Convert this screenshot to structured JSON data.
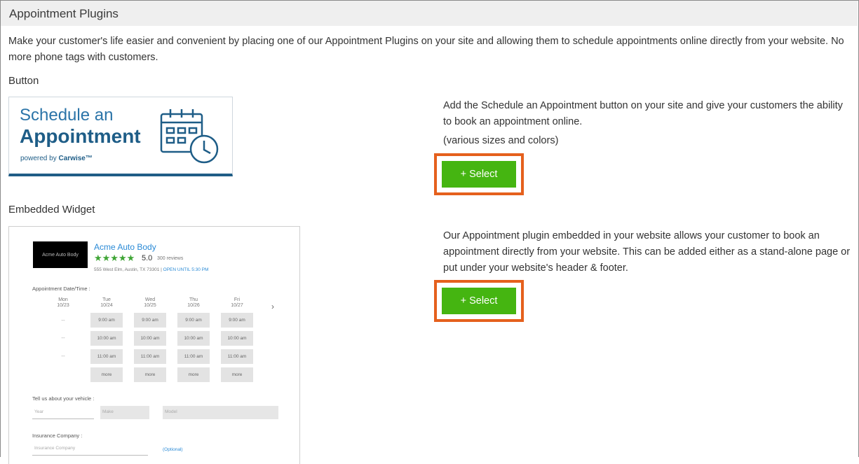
{
  "page": {
    "title": "Appointment Plugins",
    "intro": "Make your customer's life easier and convenient by placing one of our Appointment Plugins on your site and allowing them to schedule appointments online directly from your website. No more phone tags with customers."
  },
  "button_section": {
    "heading": "Button",
    "preview": {
      "line1": "Schedule an",
      "line2": "Appointment",
      "powered_prefix": "powered by ",
      "powered_brand": "Carwise™"
    },
    "description": "Add the Schedule an Appointment button on your site and give your customers the ability to book an appointment online.",
    "note": "(various sizes and colors)",
    "select_label": "+ Select"
  },
  "widget_section": {
    "heading": "Embedded Widget",
    "description": "Our Appointment plugin embedded in your website allows your customer to book an appointment directly from your website. This can be added either as a stand-alone page or put under your website's header & footer.",
    "select_label": "+ Select",
    "preview": {
      "logo_text": "Acme Auto Body",
      "name": "Acme Auto Body",
      "stars": "★★★★★",
      "score": "5.0",
      "reviews": "300 reviews",
      "address": "555 West Elm, Austin, TX 73301",
      "separator": " | ",
      "open": "OPEN UNTIL 5:30 PM",
      "date_label": "Appointment Date/Time :",
      "days": [
        {
          "day": "Mon",
          "date": "10/23"
        },
        {
          "day": "Tue",
          "date": "10/24"
        },
        {
          "day": "Wed",
          "date": "10/25"
        },
        {
          "day": "Thu",
          "date": "10/26"
        },
        {
          "day": "Fri",
          "date": "10/27"
        }
      ],
      "unavailable": "--",
      "times": [
        "9:00 am",
        "10:00 am",
        "11:00 am"
      ],
      "more": "more",
      "next_glyph": "›",
      "vehicle_label": "Tell us about your vehicle :",
      "year_placeholder": "Year",
      "make_placeholder": "Make",
      "model_placeholder": "Model",
      "insurance_label": "Insurance Company :",
      "insurance_placeholder": "Insurance Company",
      "optional": "(Optional)"
    }
  },
  "colors": {
    "select_green": "#45b511",
    "highlight_orange": "#e5601d",
    "brand_blue": "#1e5d87"
  }
}
